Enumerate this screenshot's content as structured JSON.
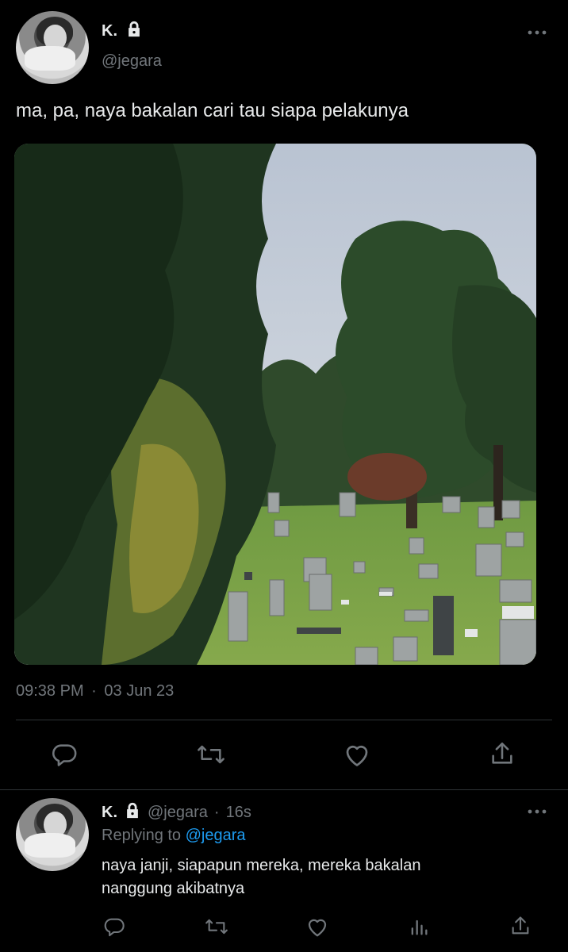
{
  "main_tweet": {
    "author_name": "K.",
    "handle": "@jegara",
    "text": "ma, pa, naya bakalan cari tau siapa pelakunya",
    "time": "09:38 PM",
    "separator": "·",
    "date": "03 Jun 23"
  },
  "reply": {
    "author_name": "K.",
    "handle": "@jegara",
    "separator": "·",
    "age": "16s",
    "replying_to_label": "Replying to",
    "replying_to_handle": "@jegara",
    "text_line1": "naya janji, siapapun mereka, mereka bakalan",
    "text_line2": "nanggung akibatnya"
  },
  "icons": {
    "more": "more-dots-icon",
    "lock": "lock-icon",
    "reply": "reply-icon",
    "retweet": "retweet-icon",
    "like": "heart-icon",
    "share": "share-icon",
    "analytics": "analytics-icon"
  },
  "colors": {
    "background": "#000000",
    "text": "#e7e9ea",
    "secondary": "#71767b",
    "divider": "#2f3336",
    "accent": "#1d9bf0"
  }
}
